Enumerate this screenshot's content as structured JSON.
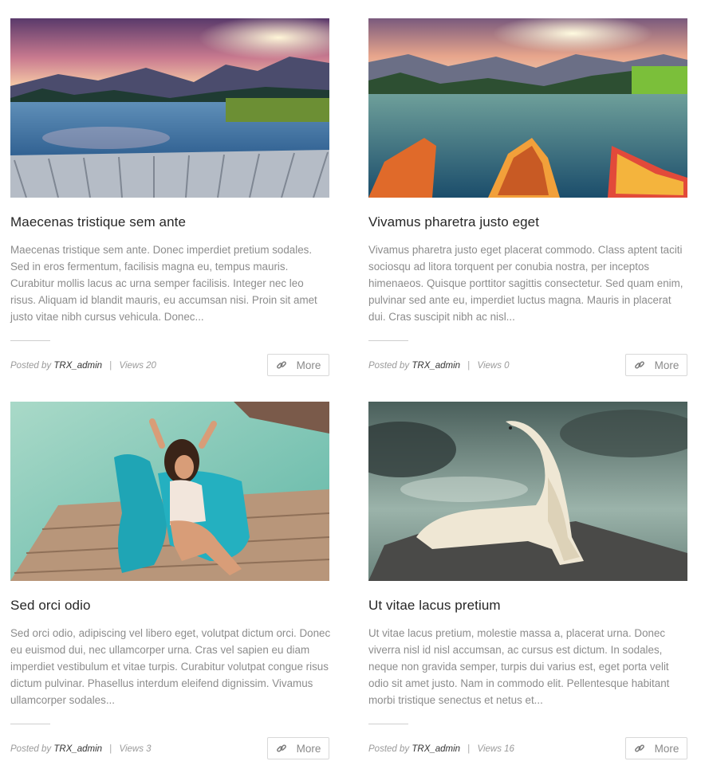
{
  "posts": [
    {
      "image": "mountain-lake-sunset",
      "title": "Maecenas tristique sem ante",
      "excerpt": "Maecenas tristique sem ante. Donec imperdiet pretium sodales. Sed in eros fermentum, facilisis magna eu, tempus mauris. Curabitur mollis lacus ac urna semper facilisis. Integer nec leo risus. Aliquam id blandit mauris, eu accumsan nisi. Proin sit amet justo vitae nibh cursus vehicula. Donec...",
      "posted_by_label": "Posted by",
      "author": "TRX_admin",
      "views_label": "Views 20",
      "more_label": "More"
    },
    {
      "image": "lake-boats",
      "title": "Vivamus pharetra justo eget",
      "excerpt": "Vivamus pharetra justo eget placerat commodo. Class aptent taciti sociosqu ad litora torquent per conubia nostra, per inceptos himenaeos. Quisque porttitor sagittis consectetur. Sed quam enim, pulvinar sed ante eu, imperdiet luctus magna. Mauris in placerat dui. Cras suscipit nibh ac nisl...",
      "posted_by_label": "Posted by",
      "author": "TRX_admin",
      "views_label": "Views 0",
      "more_label": "More"
    },
    {
      "image": "woman-pool-chair",
      "title": "Sed orci odio",
      "excerpt": "Sed orci odio, adipiscing vel libero eget, volutpat dictum orci. Donec eu euismod dui, nec ullamcorper urna. Cras vel sapien eu diam imperdiet vestibulum et vitae turpis. Curabitur volutpat congue risus dictum pulvinar. Phasellus interdum eleifend dignissim. Vivamus ullamcorper sodales...",
      "posted_by_label": "Posted by",
      "author": "TRX_admin",
      "views_label": "Views 3",
      "more_label": "More"
    },
    {
      "image": "polar-bear-rock",
      "title": "Ut vitae lacus pretium",
      "excerpt": "Ut vitae lacus pretium, molestie massa a, placerat urna. Donec viverra nisl id nisl accumsan, ac cursus est dictum. In sodales, neque non gravida semper, turpis dui varius est, eget porta velit odio sit amet justo. Nam in commodo elit. Pellentesque habitant morbi tristique senectus et netus et...",
      "posted_by_label": "Posted by",
      "author": "TRX_admin",
      "views_label": "Views 16",
      "more_label": "More"
    }
  ],
  "icons": {
    "more": "link-icon"
  },
  "colors": {
    "text": "#262626",
    "muted": "#8c8c8c",
    "border": "#d8d8d8"
  }
}
